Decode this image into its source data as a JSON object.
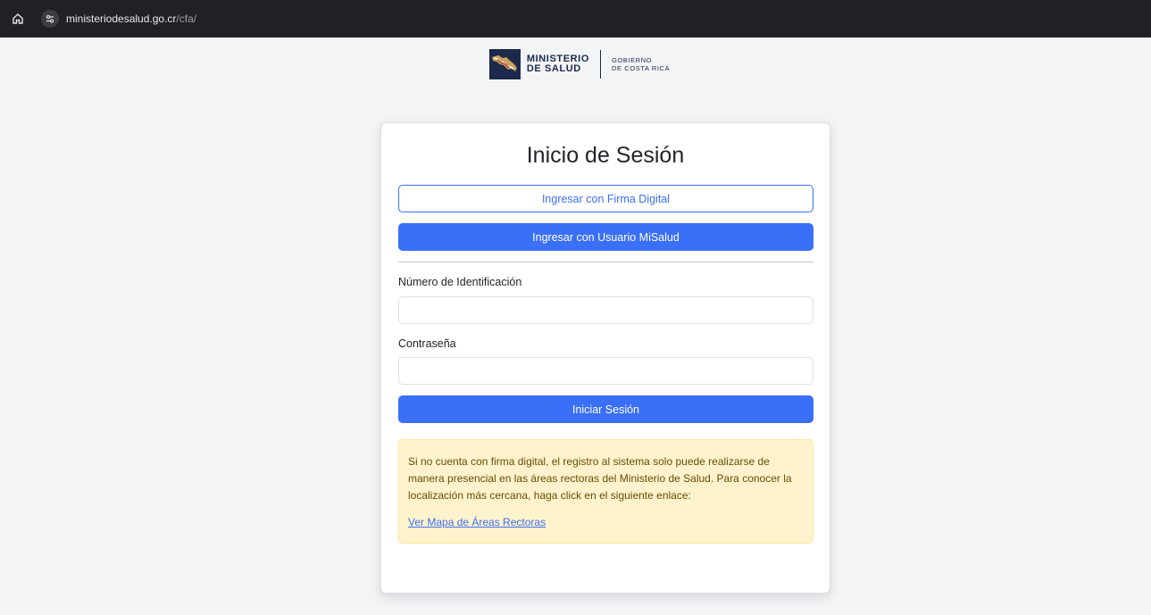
{
  "browser": {
    "url_host": "ministeriodesalud.go.cr",
    "url_path": "/cfa/"
  },
  "logo": {
    "main_line1": "MINISTERIO",
    "main_line2": "DE SALUD",
    "sub_line1": "GOBIERNO",
    "sub_line2": "DE COSTA RICA"
  },
  "login": {
    "title": "Inicio de Sesión",
    "firma_button": "Ingresar con Firma Digital",
    "misalud_button": "Ingresar con Usuario MiSalud",
    "id_label": "Número de Identificación",
    "id_value": "",
    "password_label": "Contraseña",
    "password_value": "",
    "submit_button": "Iniciar Sesión"
  },
  "notice": {
    "text": "Si no cuenta con firma digital, el registro al sistema solo puede realizarse de manera presencial en las áreas rectoras del Ministerio de Salud. Para conocer la localización más cercana, haga click en el siguiente enlace:",
    "link": "Ver Mapa de Áreas Rectoras"
  },
  "colors": {
    "primary": "#3a6ff7",
    "browser_bar": "#202124",
    "alert_bg": "#fff3cd",
    "logo_navy": "#1b2a4a"
  },
  "icons": {
    "home": "home-icon",
    "site_info": "tune-icon"
  }
}
